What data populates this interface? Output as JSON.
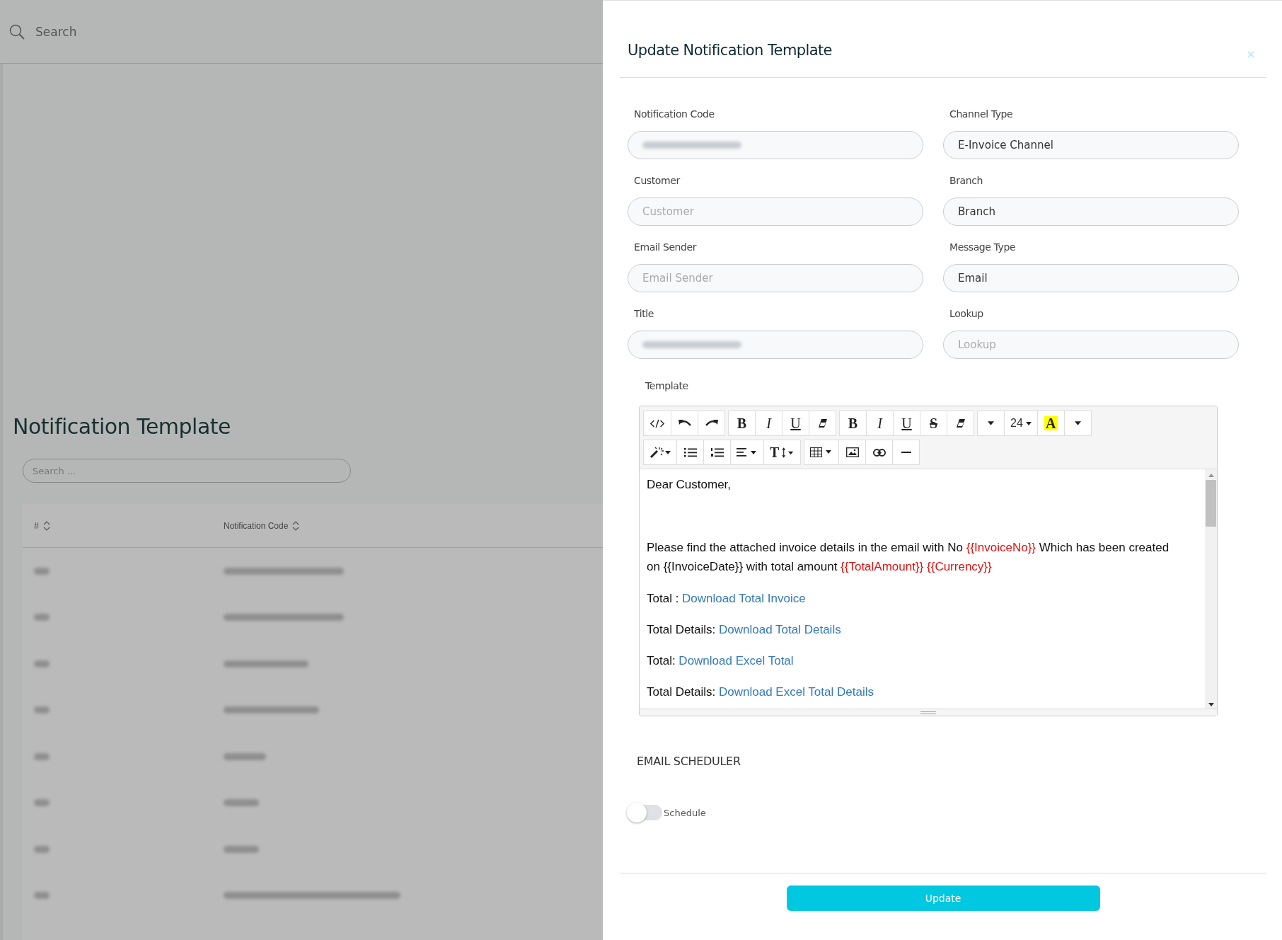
{
  "background_page": {
    "search": {
      "label": "Search"
    },
    "title": "Notification Template",
    "table_search": {
      "placeholder": "Search ..."
    },
    "table": {
      "columns": [
        "#",
        "Notification Code"
      ],
      "rows": [
        {
          "kind": "redacted"
        },
        {
          "kind": "redacted"
        },
        {
          "kind": "redacted"
        },
        {
          "kind": "redacted"
        },
        {
          "kind": "redacted"
        },
        {
          "kind": "redacted"
        },
        {
          "kind": "redacted"
        },
        {
          "kind": "redacted"
        }
      ]
    }
  },
  "dialog": {
    "title": "Update Notification Template",
    "fields": [
      {
        "label": "Notification Code",
        "kind": "redacted"
      },
      {
        "label": "Channel Type",
        "kind": "value",
        "value": "E-Invoice Channel"
      },
      {
        "label": "Customer",
        "kind": "placeholder",
        "placeholder": "Customer"
      },
      {
        "label": "Branch",
        "kind": "value",
        "value": "Branch"
      },
      {
        "label": "Email Sender",
        "kind": "placeholder",
        "placeholder": "Email Sender"
      },
      {
        "label": "Message Type",
        "kind": "value",
        "value": "Email"
      },
      {
        "label": "Title",
        "kind": "redacted"
      },
      {
        "label": "Lookup",
        "kind": "placeholder",
        "placeholder": "Lookup"
      }
    ],
    "template": {
      "label": "Template",
      "toolbar": [
        [
          [
            {
              "kind": "code"
            },
            {
              "kind": "undo"
            },
            {
              "kind": "redo"
            }
          ],
          [
            {
              "kind": "bold",
              "label": "B"
            },
            {
              "kind": "italic",
              "label": "I"
            },
            {
              "kind": "underline",
              "label": "U"
            },
            {
              "kind": "eraser"
            }
          ],
          [
            {
              "kind": "bold",
              "label": "B"
            },
            {
              "kind": "italic",
              "label": "I"
            },
            {
              "kind": "underline",
              "label": "U"
            },
            {
              "kind": "strike",
              "label": "S"
            },
            {
              "kind": "eraser"
            }
          ],
          [
            {
              "kind": "caret"
            },
            {
              "kind": "size",
              "label": "24"
            },
            {
              "kind": "color",
              "label": "A"
            },
            {
              "kind": "caret"
            }
          ]
        ],
        [
          [
            {
              "kind": "magic"
            },
            {
              "kind": "ul"
            },
            {
              "kind": "ol"
            },
            {
              "kind": "align"
            },
            {
              "kind": "height",
              "label": "T"
            }
          ],
          [
            {
              "kind": "table"
            },
            {
              "kind": "image"
            },
            {
              "kind": "link"
            },
            {
              "kind": "hr"
            }
          ]
        ]
      ],
      "paragraphs": [
        [
          {
            "kind": "plain",
            "text": "Dear Customer,"
          }
        ],
        [
          {
            "kind": "blank"
          }
        ],
        [
          {
            "kind": "plain",
            "text": "Please find the attached invoice details in the email with No "
          },
          {
            "kind": "variable",
            "text": "{{InvoiceNo}}"
          },
          {
            "kind": "plain",
            "text": " Which has been created on {{InvoiceDate}} with total amount "
          },
          {
            "kind": "variable",
            "text": "{{TotalAmount}}"
          },
          {
            "kind": "variable",
            "text": " {{Currency}}"
          }
        ],
        [
          {
            "kind": "plain",
            "text": "Total : "
          },
          {
            "kind": "link",
            "text": "Download Total Invoice"
          }
        ],
        [
          {
            "kind": "plain",
            "text": "Total Details: "
          },
          {
            "kind": "link",
            "text": "Download Total Details"
          }
        ],
        [
          {
            "kind": "plain",
            "text": "Total: "
          },
          {
            "kind": "link",
            "text": "Download Excel Total"
          }
        ],
        [
          {
            "kind": "plain",
            "text": "Total Details: "
          },
          {
            "kind": "link",
            "text": "Download Excel Total Details"
          }
        ]
      ]
    },
    "scheduler": {
      "heading": "EMAIL SCHEDULER",
      "toggle": {
        "label": "Schedule",
        "on": false
      }
    },
    "submit": "Update"
  }
}
